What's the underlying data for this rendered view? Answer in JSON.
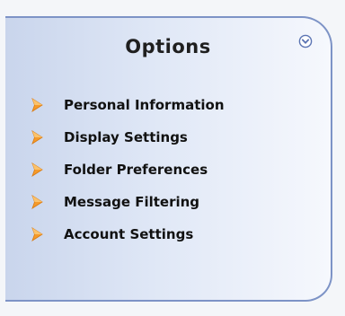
{
  "panel": {
    "title": "Options",
    "collapse_icon": "chevron-down-circle-icon",
    "accent_color": "#7d93c6",
    "bullet_color": "#f59a2a"
  },
  "menu": {
    "items": [
      {
        "label": "Personal Information",
        "icon": "arrow-bullet-icon"
      },
      {
        "label": "Display Settings",
        "icon": "arrow-bullet-icon"
      },
      {
        "label": "Folder Preferences",
        "icon": "arrow-bullet-icon"
      },
      {
        "label": "Message Filtering",
        "icon": "arrow-bullet-icon"
      },
      {
        "label": "Account Settings",
        "icon": "arrow-bullet-icon"
      }
    ]
  }
}
